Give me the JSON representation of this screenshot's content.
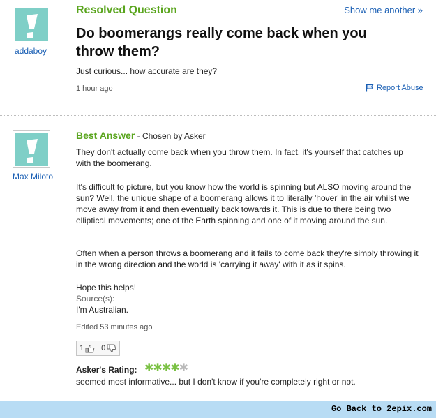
{
  "question": {
    "status": "Resolved Question",
    "show_another": "Show me another »",
    "asker": "addaboy",
    "title": "Do boomerangs really come back when you throw them?",
    "details": "Just curious... how accurate are they?",
    "time": "1 hour ago",
    "report_abuse": "Report Abuse"
  },
  "answer": {
    "label": "Best Answer",
    "chosen_by": " - Chosen by Asker",
    "answerer": "Max Miloto",
    "paragraphs": [
      "They don't actually come back when you throw them. In fact, it's yourself that catches up with the boomerang.",
      "It's difficult to picture, but you know how the world is spinning but ALSO moving around the sun? Well, the unique shape of a boomerang allows it to literally 'hover' in the air whilst we move away from it and then eventually back towards it. This is due to there being two elliptical movements; one of the Earth spinning and one of it moving around the sun.",
      "Often when a person throws a boomerang and it fails to come back they're simply throwing it in the wrong direction and the world is 'carrying it away' with it as it spins.",
      "Hope this helps!"
    ],
    "sources_label": "Source(s):",
    "sources_text": "I'm Australian.",
    "edited": "Edited 53 minutes ago",
    "thumbs_up_count": "1",
    "thumbs_down_count": "0",
    "rating_label": "Asker's Rating:",
    "rating": 4,
    "rating_max": 5,
    "rating_comment": "seemed most informative... but I don't know if you're completely right or not."
  },
  "footer": {
    "link": "Go Back to 2epix.com"
  },
  "colors": {
    "green": "#5aa51e",
    "link_blue": "#1a5fb4",
    "avatar_teal": "#7fcfc7",
    "footer_blue": "#b8dcf4"
  }
}
